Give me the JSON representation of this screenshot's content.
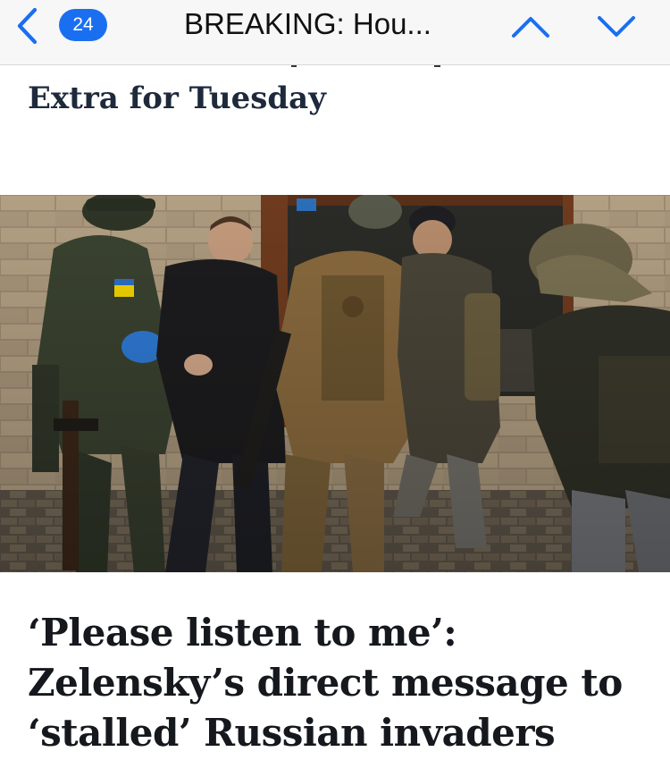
{
  "nav": {
    "unread_count": "24",
    "title": "BREAKING: Hou..."
  },
  "icons": {
    "back": "chevron-left-icon",
    "prev_article": "chevron-up-icon",
    "next_article": "chevron-down-icon"
  },
  "colors": {
    "accent": "#1a6ff0",
    "headline": "#15181d",
    "subheadline": "#1e2a3c"
  },
  "previous_article": {
    "title_tail": "Extra for Tuesday"
  },
  "article": {
    "headline": "‘Please listen to me’: Zelensky’s direct message to ‘stalled’ Russian invaders"
  }
}
